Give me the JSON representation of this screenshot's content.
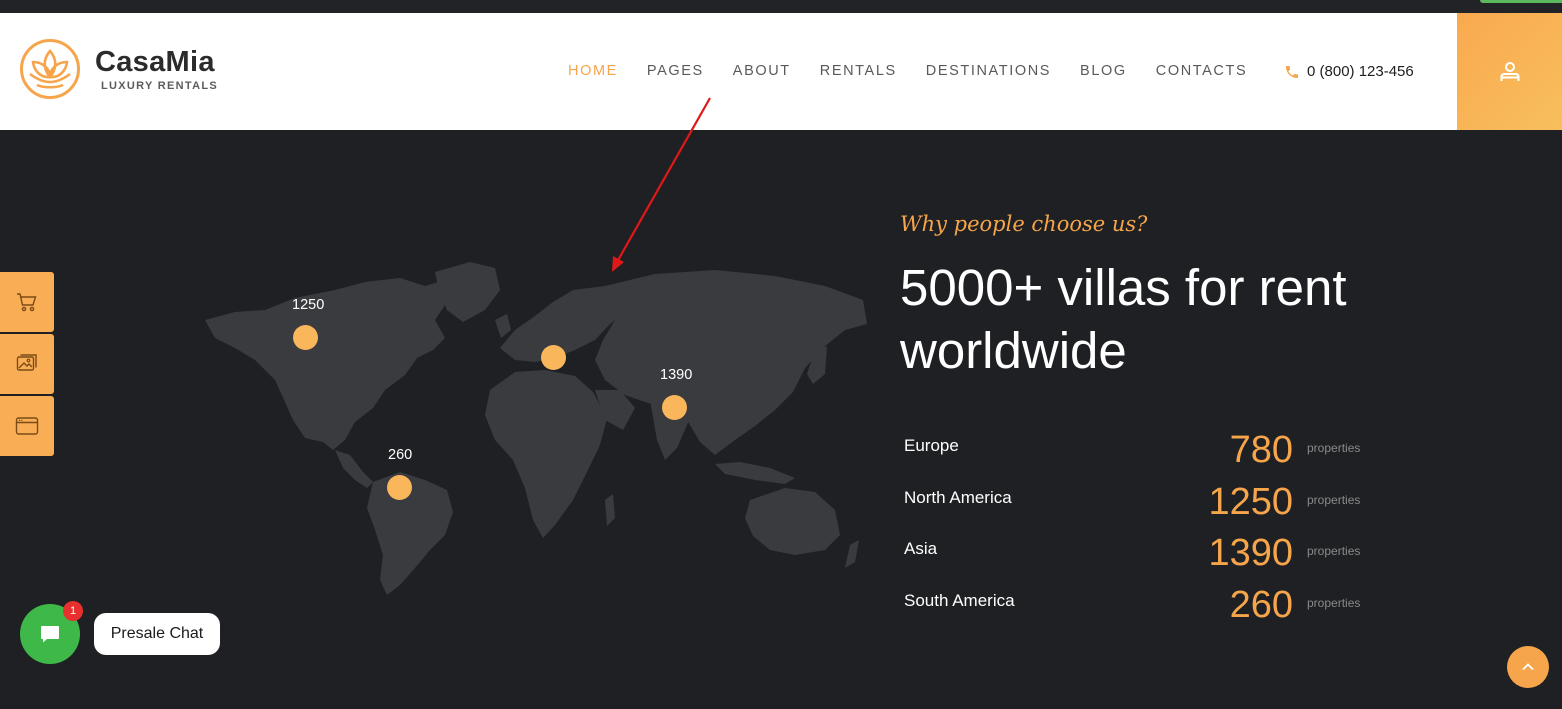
{
  "brand": {
    "name": "CasaMia",
    "tagline": "LUXURY RENTALS",
    "accent_color": "#f6a54a",
    "logo_icon": "lotus-icon"
  },
  "nav": {
    "items": [
      {
        "label": "HOME",
        "active": true
      },
      {
        "label": "PAGES",
        "active": false
      },
      {
        "label": "ABOUT",
        "active": false
      },
      {
        "label": "RENTALS",
        "active": false
      },
      {
        "label": "DESTINATIONS",
        "active": false
      },
      {
        "label": "BLOG",
        "active": false
      },
      {
        "label": "CONTACTS",
        "active": false
      }
    ]
  },
  "contact": {
    "phone": "0 (800) 123-456",
    "phone_icon": "phone-icon"
  },
  "account": {
    "icon": "user-icon"
  },
  "side_tools": [
    {
      "icon": "cart-icon"
    },
    {
      "icon": "gallery-icon"
    },
    {
      "icon": "browser-window-icon"
    }
  ],
  "map": {
    "pins": [
      {
        "label": "1250"
      },
      {
        "label": ""
      },
      {
        "label": "1390"
      },
      {
        "label": "260"
      }
    ]
  },
  "section": {
    "eyebrow": "Why people choose us?",
    "headline": "5000+ villas for rent worldwide",
    "stats": [
      {
        "region": "Europe",
        "value": "780",
        "unit": "properties"
      },
      {
        "region": "North America",
        "value": "1250",
        "unit": "properties"
      },
      {
        "region": "Asia",
        "value": "1390",
        "unit": "properties"
      },
      {
        "region": "South America",
        "value": "260",
        "unit": "properties"
      }
    ]
  },
  "chat": {
    "label": "Presale Chat",
    "badge_count": "1",
    "icon": "chat-bubble-icon",
    "button_color": "#3fb84a"
  },
  "scroll_top": {
    "icon": "chevron-up-icon"
  },
  "annotation": {
    "arrow_color": "#e01818"
  }
}
